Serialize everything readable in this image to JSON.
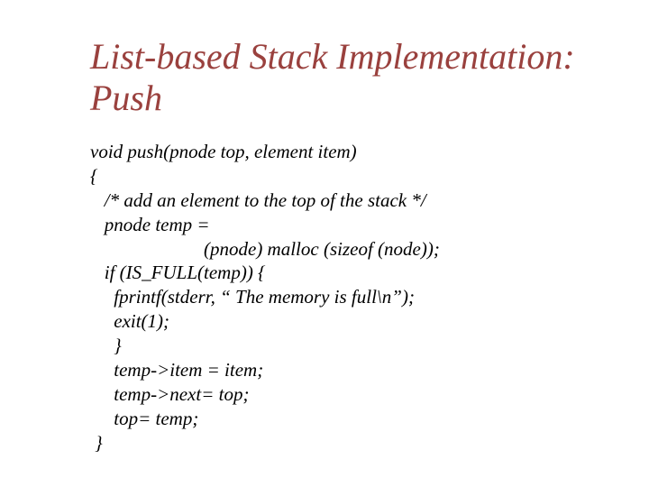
{
  "title": "List-based Stack Implementation: Push",
  "code": {
    "l1": "void push(pnode top, element item)",
    "l2": "{",
    "l3": "   /* add an element to the top of the stack */",
    "l4": "   pnode temp =",
    "l5": "                        (pnode) malloc (sizeof (node));",
    "l6": "   if (IS_FULL(temp)) {",
    "l7": "     fprintf(stderr, “ The memory is full\\n”);",
    "l8": "     exit(1);",
    "l9": "     }",
    "l10": "     temp->item = item;",
    "l11": "     temp->next= top;",
    "l12": "     top= temp;",
    "l13": " }"
  }
}
